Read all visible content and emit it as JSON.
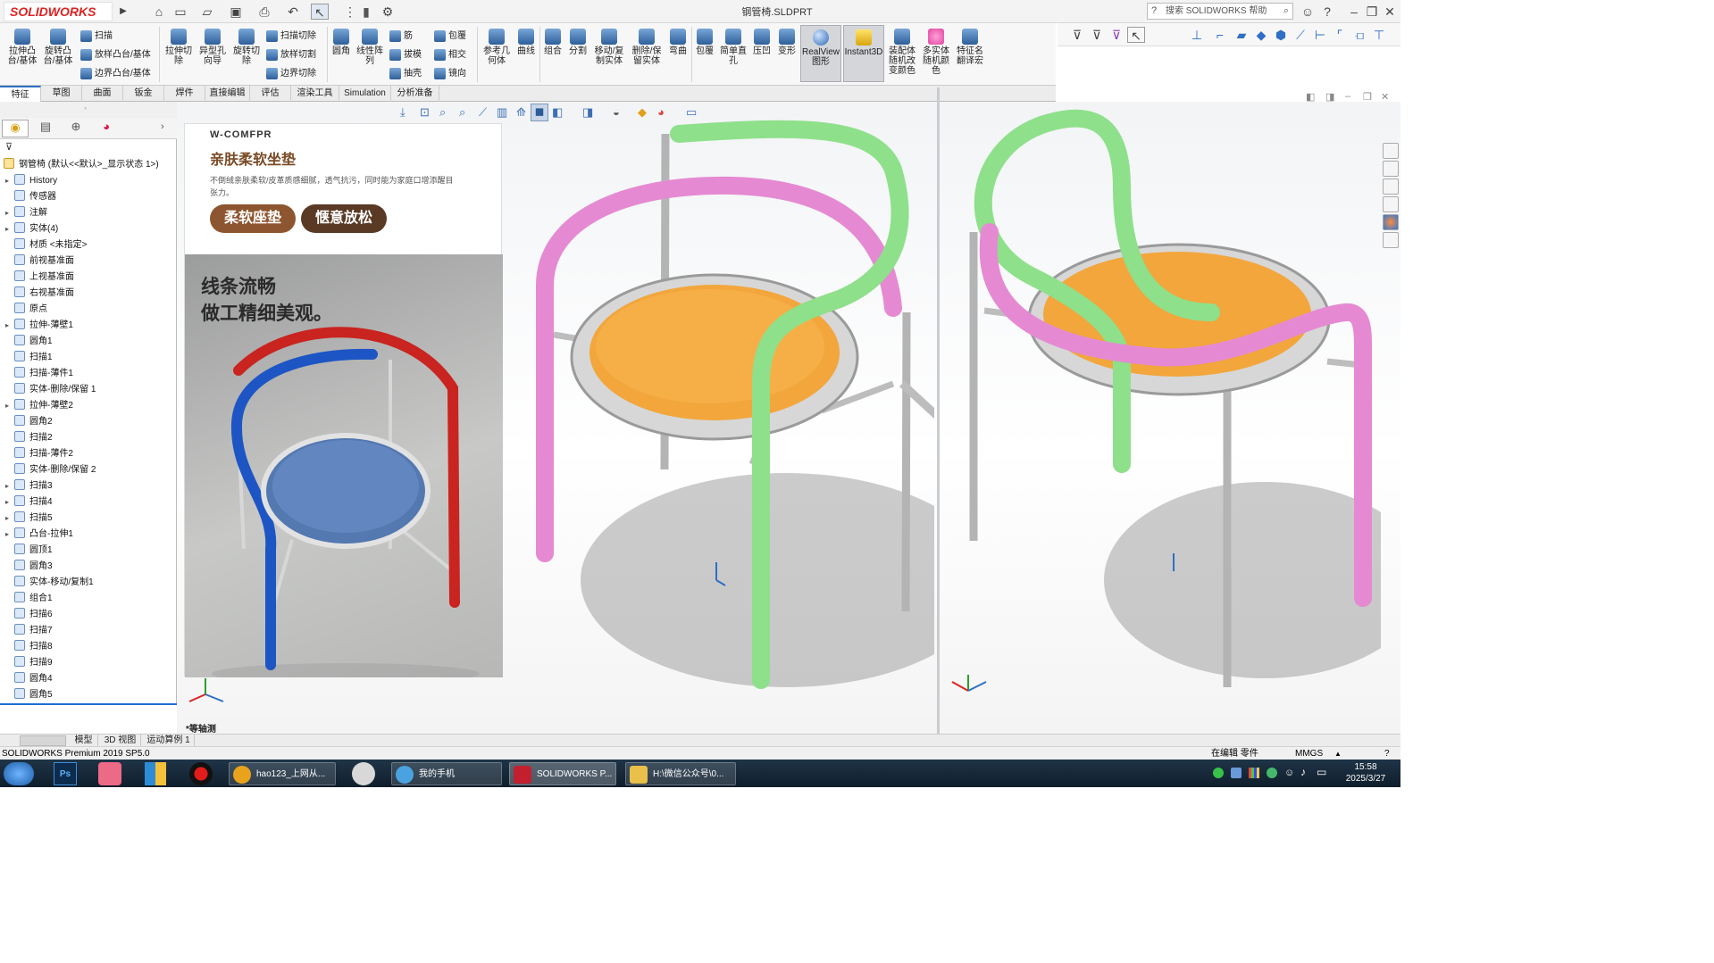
{
  "app": {
    "logo": "SOLIDWORKS",
    "document_title": "钢管椅.SLDPRT",
    "search_placeholder": "搜索 SOLIDWORKS 帮助"
  },
  "ribbon": {
    "large_buttons": [
      {
        "label": "拉伸凸台/基体",
        "icon": "extrude-boss-icon"
      },
      {
        "label": "旋转凸台/基体",
        "icon": "revolve-boss-icon"
      },
      {
        "label": "拉伸切除",
        "icon": "extrude-cut-icon"
      },
      {
        "label": "异型孔向导",
        "icon": "hole-wizard-icon"
      },
      {
        "label": "旋转切除",
        "icon": "revolve-cut-icon"
      },
      {
        "label": "圆角",
        "icon": "fillet-icon"
      },
      {
        "label": "线性阵列",
        "icon": "linear-pattern-icon"
      },
      {
        "label": "参考几何体",
        "icon": "reference-geometry-icon"
      },
      {
        "label": "曲线",
        "icon": "curves-icon"
      },
      {
        "label": "组合",
        "icon": "combine-icon"
      },
      {
        "label": "分割",
        "icon": "split-icon"
      },
      {
        "label": "移动/复制实体",
        "icon": "move-copy-icon"
      },
      {
        "label": "删除/保留实体",
        "icon": "delete-keep-icon"
      },
      {
        "label": "弯曲",
        "icon": "flex-icon"
      },
      {
        "label": "包覆",
        "icon": "wrap-icon"
      },
      {
        "label": "简单直孔",
        "icon": "simple-hole-icon"
      },
      {
        "label": "压凹",
        "icon": "indent-icon"
      },
      {
        "label": "变形",
        "icon": "deform-icon"
      },
      {
        "label": "RealView 图形",
        "icon": "realview-icon"
      },
      {
        "label": "Instant3D",
        "icon": "instant3d-icon"
      },
      {
        "label": "装配体随机改变颜色",
        "icon": "random-color-icon"
      },
      {
        "label": "多实体随机颜色",
        "icon": "multibody-color-icon"
      },
      {
        "label": "特征名翻译宏",
        "icon": "macro-icon"
      }
    ],
    "small_buttons": [
      {
        "label": "扫描"
      },
      {
        "label": "放样凸台/基体"
      },
      {
        "label": "边界凸台/基体"
      },
      {
        "label": "扫描切除"
      },
      {
        "label": "放样切割"
      },
      {
        "label": "边界切除"
      },
      {
        "label": "筋"
      },
      {
        "label": "拔模"
      },
      {
        "label": "抽壳"
      },
      {
        "label": "包覆"
      },
      {
        "label": "相交"
      },
      {
        "label": "镜向"
      }
    ],
    "tabs": [
      "特征",
      "草图",
      "曲面",
      "钣金",
      "焊件",
      "直接编辑",
      "评估",
      "渲染工具",
      "Simulation",
      "分析准备"
    ]
  },
  "feature_tree": {
    "root": "钢管椅 (默认<<默认>_显示状态 1>)",
    "nodes": [
      {
        "label": "History",
        "icon": "history-icon",
        "expand": true
      },
      {
        "label": "传感器",
        "icon": "sensor-icon",
        "expand": false
      },
      {
        "label": "注解",
        "icon": "annotation-icon",
        "expand": true
      },
      {
        "label": "实体(4)",
        "icon": "solid-bodies-icon",
        "expand": true
      },
      {
        "label": "材质 <未指定>",
        "icon": "material-icon",
        "expand": false
      },
      {
        "label": "前视基准面",
        "icon": "plane-icon",
        "expand": false
      },
      {
        "label": "上视基准面",
        "icon": "plane-icon",
        "expand": false
      },
      {
        "label": "右视基准面",
        "icon": "plane-icon",
        "expand": false
      },
      {
        "label": "原点",
        "icon": "origin-icon",
        "expand": false
      },
      {
        "label": "拉伸-薄壁1",
        "icon": "extrude-icon",
        "expand": true
      },
      {
        "label": "圆角1",
        "icon": "fillet-icon",
        "expand": false
      },
      {
        "label": "扫描1",
        "icon": "sweep-icon",
        "expand": false
      },
      {
        "label": "扫描-薄件1",
        "icon": "sweep-icon",
        "expand": false
      },
      {
        "label": "实体-删除/保留 1",
        "icon": "delete-body-icon",
        "expand": false
      },
      {
        "label": "拉伸-薄壁2",
        "icon": "extrude-icon",
        "expand": true
      },
      {
        "label": "圆角2",
        "icon": "fillet-icon",
        "expand": false
      },
      {
        "label": "扫描2",
        "icon": "sweep-icon",
        "expand": false
      },
      {
        "label": "扫描-薄件2",
        "icon": "sweep-icon",
        "expand": false
      },
      {
        "label": "实体-删除/保留 2",
        "icon": "delete-body-icon",
        "expand": false
      },
      {
        "label": "扫描3",
        "icon": "sweep-icon",
        "expand": true
      },
      {
        "label": "扫描4",
        "icon": "sweep-icon",
        "expand": true
      },
      {
        "label": "扫描5",
        "icon": "sweep-icon",
        "expand": true
      },
      {
        "label": "凸台-拉伸1",
        "icon": "extrude-icon",
        "expand": true
      },
      {
        "label": "圆顶1",
        "icon": "dome-icon",
        "expand": false
      },
      {
        "label": "圆角3",
        "icon": "fillet-icon",
        "expand": false
      },
      {
        "label": "实体-移动/复制1",
        "icon": "move-body-icon",
        "expand": false
      },
      {
        "label": "组合1",
        "icon": "combine-icon",
        "expand": false
      },
      {
        "label": "扫描6",
        "icon": "sweep-icon",
        "expand": false
      },
      {
        "label": "扫描7",
        "icon": "sweep-icon",
        "expand": false
      },
      {
        "label": "扫描8",
        "icon": "sweep-icon",
        "expand": false
      },
      {
        "label": "扫描9",
        "icon": "sweep-icon",
        "expand": false
      },
      {
        "label": "圆角4",
        "icon": "fillet-icon",
        "expand": false
      },
      {
        "label": "圆角5",
        "icon": "fillet-icon",
        "expand": false
      }
    ]
  },
  "viewport": {
    "view_label": "*等轴测"
  },
  "ad": {
    "brand": "W-COMFPR",
    "title": "亲肤柔软坐垫",
    "description": "不倒绒亲肤柔软/皮革质感细腻，透气抗污，同时能为家庭口增添醒目张力。",
    "pill1": "柔软座垫",
    "pill2": "惬意放松",
    "slogan1": "线条流畅",
    "slogan2": "做工精细美观。"
  },
  "bottom_tabs": [
    "模型",
    "3D 视图",
    "运动算例 1"
  ],
  "status": {
    "left": "SOLIDWORKS Premium 2019 SP5.0",
    "mode": "在编辑 零件",
    "units": "MMGS"
  },
  "taskbar": {
    "items": [
      {
        "label": "hao123_上网从...",
        "color": "#e9a21b"
      },
      {
        "label": "我的手机",
        "color": "#4aa3e0"
      },
      {
        "label": "SOLIDWORKS P...",
        "color": "#c3202f"
      },
      {
        "label": "H:\\微信公众号\\0...",
        "color": "#e8c04a"
      }
    ],
    "time": "15:58",
    "date": "2025/3/27"
  },
  "colors": {
    "seat": "#f2a63c",
    "frame": "#c9c9c9",
    "tube_pink": "#e58ad2",
    "tube_green": "#8ee08a",
    "photo_red": "#c9241f",
    "photo_blue": "#1d55c4",
    "pill_brown": "#8d5630"
  }
}
